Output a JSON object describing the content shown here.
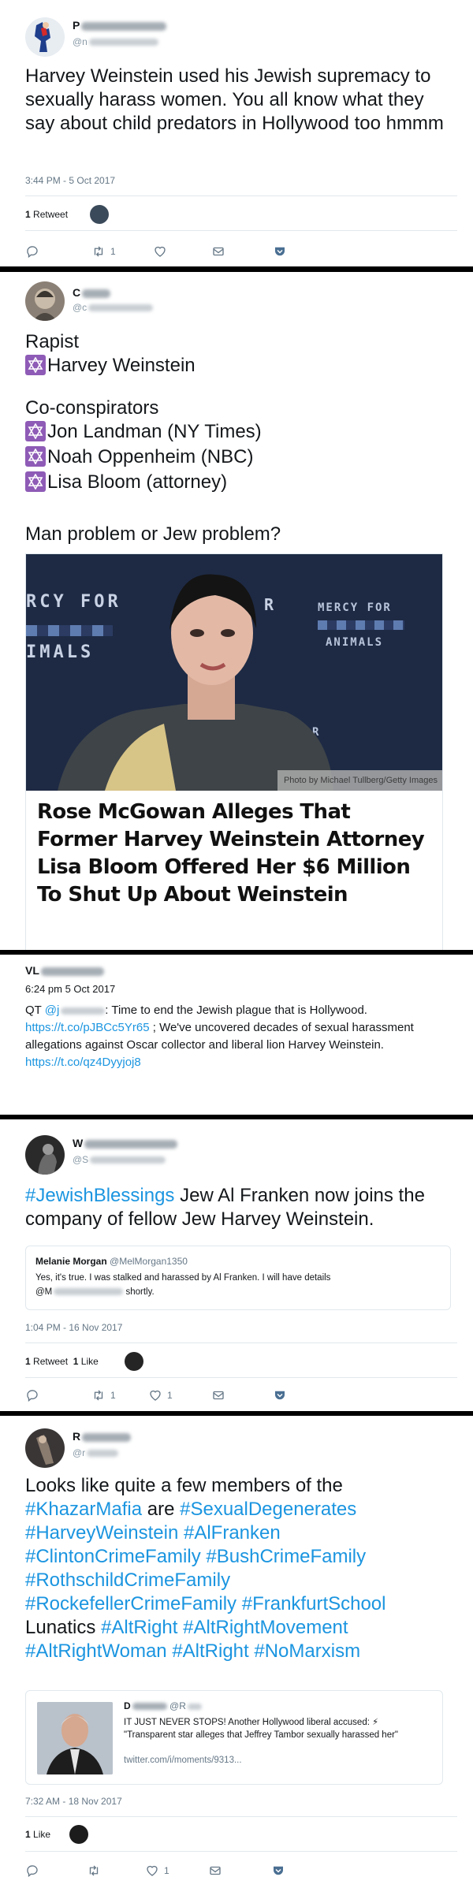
{
  "tweet1": {
    "username": "P",
    "handle": "@n",
    "text": "Harvey Weinstein used his Jewish supremacy to sexually harass women. You all know what they say about child predators in Hollywood too hmmm",
    "timestamp": "3:44 PM - 5 Oct 2017",
    "retweet_count": "1",
    "retweet_label": "Retweet",
    "action_retweets": "1"
  },
  "tweet2": {
    "username": "C",
    "handle": "@c",
    "line_rapist": "Rapist",
    "line_weinstein": "Harvey Weinstein",
    "line_coconspirators": "Co-conspirators",
    "line_landman": "Jon Landman (NY Times)",
    "line_oppenheim": "Noah Oppenheim (NBC)",
    "line_bloom": "Lisa Bloom (attorney)",
    "line_question": "Man problem or Jew problem?",
    "photo_backdrop_1": "RCY FOR",
    "photo_backdrop_2": "IMALS",
    "photo_backdrop_3": "R",
    "photo_backdrop_4": "MERCY FOR",
    "photo_backdrop_5": "ANIMALS",
    "photo_backdrop_6": "ERCY FOR",
    "photo_credit": "Photo by Michael Tullberg/Getty Images",
    "headline": "Rose McGowan Alleges That Former Harvey Weinstein Attorney Lisa Bloom Offered Her $6 Million To Shut Up About Weinstein"
  },
  "tweet3": {
    "username": "VL",
    "timestamp": "6:24 pm 5 Oct 2017",
    "qt_prefix": "QT",
    "qt_handle": "@j",
    "qt_text": ": Time to end the Jewish plague that is Hollywood.",
    "link1": "https://t.co/pJBCc5Yr65",
    "body": " ; We've uncovered decades of sexual harassment allegations against Oscar collector and liberal lion Harvey Weinstein.",
    "link2": "https://t.co/qz4Dyyjoj8"
  },
  "tweet4": {
    "username": "W",
    "handle": "@S",
    "hashtag": "#JewishBlessings",
    "text": " Jew Al Franken now joins the company of fellow Jew Harvey Weinstein.",
    "quote_name": "Melanie Morgan",
    "quote_handle": "@MelMorgan1350",
    "quote_text_1": "Yes, it's true. I was stalked and harassed by Al Franken. I will have details",
    "quote_text_2a": "@M",
    "quote_text_2b": " shortly.",
    "timestamp": "1:04 PM - 16 Nov 2017",
    "retweet_count": "1",
    "retweet_label": "Retweet",
    "like_count": "1",
    "like_label": "Like",
    "action_retweets": "1",
    "action_likes": "1"
  },
  "tweet5": {
    "username": "R",
    "handle": "@r",
    "t1": "Looks like quite a few members of the",
    "h1": "#KhazarMafia",
    "t2": " are ",
    "h2": "#SexualDegenerates",
    "h3": "#HarveyWeinstein",
    "h4": "#AlFranken",
    "h5": "#ClintonCrimeFamily",
    "h6": "#BushCrimeFamily",
    "h7": "#RothschildCrimeFamily",
    "h8": "#RockefellerCrimeFamily",
    "h9": "#FrankfurtSchool",
    "t3": "Lunatics ",
    "h10": "#AltRight",
    "h11": "#AltRightMovement",
    "h12": "#AltRightWoman",
    "h13": "#AltRight",
    "h14": "#NoMarxism",
    "quote_name": "D",
    "quote_handle": "@R",
    "quote_line1": "IT JUST NEVER STOPS! Another Hollywood liberal accused: ⚡",
    "quote_line2": "\"Transparent star alleges that Jeffrey Tambor sexually harassed her\"",
    "quote_link": "twitter.com/i/moments/9313...",
    "timestamp": "7:32 AM - 18 Nov 2017",
    "like_count": "1",
    "like_label": "Like",
    "action_likes": "1"
  },
  "colors": {
    "link": "#1b95e0",
    "star_bg": "#8e5bb6",
    "separator": "#000000"
  }
}
